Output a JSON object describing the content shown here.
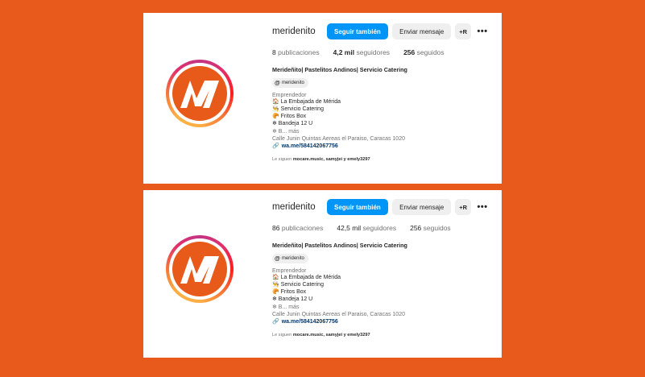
{
  "profiles": [
    {
      "username": "meridenito",
      "follow_label": "Seguir también",
      "message_label": "Enviar mensaje",
      "add_label": "+R",
      "more_label": "•••",
      "posts_count": "8",
      "posts_label": "publicaciones",
      "followers_count": "4,2 mil",
      "followers_label": "seguidores",
      "following_count": "256",
      "following_label": "seguidos",
      "full_name": "Merideñito| Pastelitos Andinos| Servicio Catering",
      "threads_handle": "meridenito",
      "category": "Emprendedor",
      "bio": [
        "🏠 La Embajada de Mérida",
        "👨‍🍳 Servicio Catering",
        "🥐 Fritos Box",
        "❄ Bandeja 12 U"
      ],
      "bio_more": "❄ B... más",
      "address": "Calle Junin Quintas Aereas el Paraiso, Caracas 1020",
      "link": "wa.me/584142067756",
      "followed_prefix": "Le siguen",
      "followed_names": "mocare.music, samyjei y emely3297"
    },
    {
      "username": "meridenito",
      "follow_label": "Seguir también",
      "message_label": "Enviar mensaje",
      "add_label": "+R",
      "more_label": "•••",
      "posts_count": "86",
      "posts_label": "publicaciones",
      "followers_count": "42,5 mil",
      "followers_label": "seguidores",
      "following_count": "256",
      "following_label": "seguidos",
      "full_name": "Merideñito| Pastelitos Andinos| Servicio Catering",
      "threads_handle": "meridenito",
      "category": "Emprendedor",
      "bio": [
        "🏠 La Embajada de Mérida",
        "👨‍🍳 Servicio Catering",
        "🥐 Fritos Box",
        "❄ Bandeja 12 U"
      ],
      "bio_more": "❄ B... más",
      "address": "Calle Junin Quintas Aereas el Paraiso, Caracas 1020",
      "link": "wa.me/584142067756",
      "followed_prefix": "Le siguen",
      "followed_names": "mocare.music, samyjei y emely3297"
    }
  ],
  "colors": {
    "background": "#e8591c",
    "follow_button": "#0095f6",
    "logo": "#e85a1a"
  }
}
